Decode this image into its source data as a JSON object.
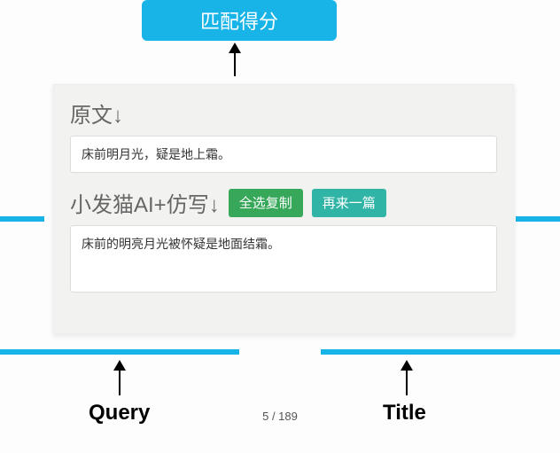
{
  "top_pill": "匹配得分",
  "panel": {
    "original_label": "原文↓",
    "original_text": "床前明月光，疑是地上霜。",
    "rewrite_label": "小发猫AI+仿写↓",
    "rewrite_text": "床前的明亮月光被怀疑是地面结霜。",
    "btn_copy": "全选复制",
    "btn_again": "再来一篇"
  },
  "labels": {
    "query": "Query",
    "title": "Title"
  },
  "pager": {
    "current": 5,
    "total": 189,
    "display": "5 / 189"
  }
}
